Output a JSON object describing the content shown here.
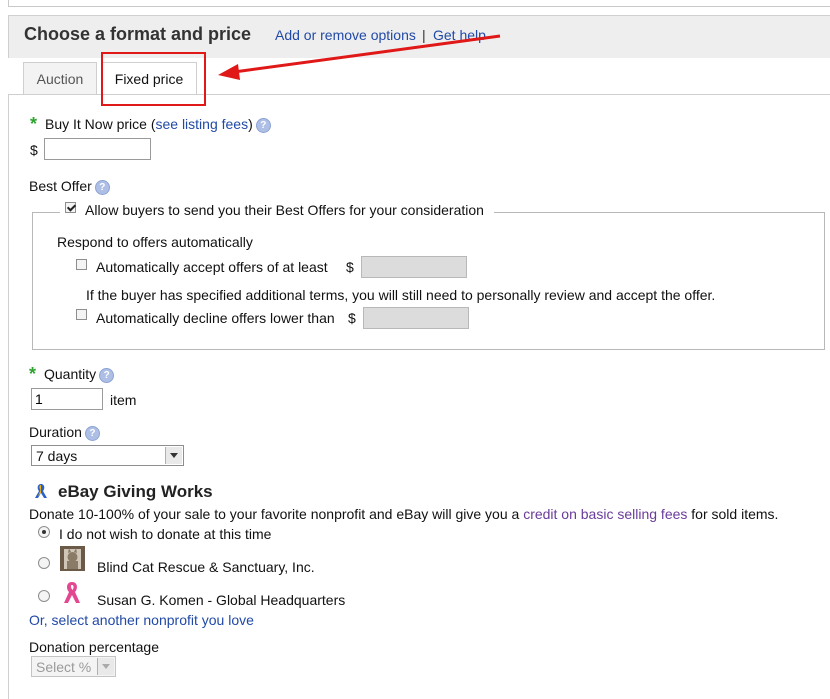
{
  "header": {
    "title": "Choose a format and price",
    "add_remove_link": "Add or remove options",
    "separator": "|",
    "help_link": "Get help"
  },
  "tabs": [
    {
      "label": "Auction",
      "active": false
    },
    {
      "label": "Fixed price",
      "active": true
    }
  ],
  "buy_it_now": {
    "required_mark": "*",
    "label": "Buy It Now price (",
    "fees_link": "see listing fees",
    "label_close": ")",
    "currency": "$",
    "value": ""
  },
  "best_offer": {
    "label": "Best Offer",
    "allow_label": "Allow buyers to send you their Best Offers for your consideration",
    "allow_checked": true,
    "respond_label": "Respond to offers automatically",
    "accept_label": "Automatically accept offers of at least",
    "accept_checked": false,
    "accept_currency": "$",
    "note": "If the buyer has specified additional terms, you will still need to personally review and accept the offer.",
    "decline_label": "Automatically decline offers lower than",
    "decline_checked": false,
    "decline_currency": "$"
  },
  "quantity": {
    "required_mark": "*",
    "label": "Quantity",
    "value": "1",
    "unit": "item"
  },
  "duration": {
    "label": "Duration",
    "selected": "7 days"
  },
  "giving_works": {
    "title": "eBay Giving Works",
    "desc_before": "Donate 10-100% of your sale to your favorite nonprofit and eBay will give you a ",
    "credit_link": "credit on basic selling fees",
    "desc_after": " for sold items.",
    "options": [
      {
        "label": "I do not wish to donate at this time",
        "selected": true
      },
      {
        "label": "Blind Cat Rescue & Sanctuary, Inc.",
        "selected": false
      },
      {
        "label": "Susan G. Komen - Global Headquarters",
        "selected": false
      }
    ],
    "select_other_link": "Or, select another nonprofit you love",
    "percentage_label": "Donation percentage",
    "percentage_selected": "Select %"
  },
  "help_glyph": "?",
  "colors": {
    "link": "#2149a6",
    "required": "#2fa32f",
    "annotation": "#e01818"
  }
}
